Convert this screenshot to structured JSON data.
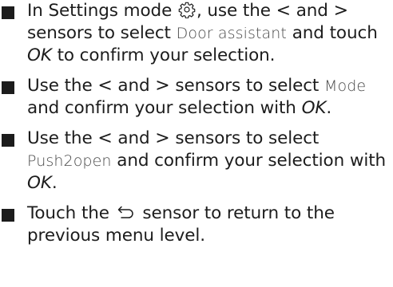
{
  "steps": [
    {
      "text_1": "In Settings mode",
      "icon": "gear-icon",
      "text_2": ", use the",
      "left_arrow": "<",
      "text_3": "and",
      "right_arrow": ">",
      "text_4": "sensors to select",
      "term": "Door assistant",
      "text_5": "and touch",
      "ok": "OK",
      "text_6": "to confirm your selection."
    },
    {
      "text_1": "Use the",
      "left_arrow": "<",
      "text_2": "and",
      "right_arrow": ">",
      "text_3": "sensors to select",
      "term": "Mode",
      "text_4": "and confirm your selection with",
      "ok": "OK",
      "text_5": "."
    },
    {
      "text_1": "Use the",
      "left_arrow": "<",
      "text_2": "and",
      "right_arrow": ">",
      "text_3": "sensors to select",
      "term": "Push2open",
      "text_4": "and confirm your selection with",
      "ok": "OK",
      "text_5": "."
    },
    {
      "text_1": "Touch the",
      "icon": "back-arrow-icon",
      "text_2": "sensor to return to the previous menu level."
    }
  ]
}
